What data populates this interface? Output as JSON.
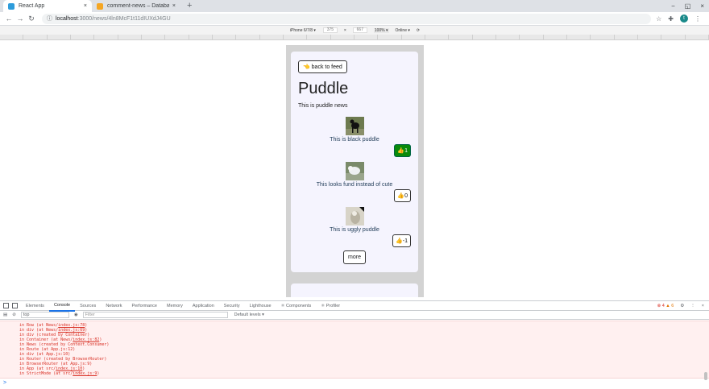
{
  "browser": {
    "tabs": [
      {
        "title": "React App",
        "close": "×",
        "color": "#2d9cdb",
        "active": true
      },
      {
        "title": "comment-news – Databa",
        "close": "×",
        "color": "#f5a623",
        "active": false
      }
    ],
    "new_tab": "+",
    "window_controls": [
      "−",
      "◱",
      "×"
    ],
    "url_host": "localhost",
    "url_path": ":3000/news/4ln8McF1t11dIUXdJ4GU",
    "profile_initial": "t"
  },
  "device_toolbar": {
    "device": "iPhone 6/7/8 ▾",
    "width": "375",
    "times": "×",
    "height": "667",
    "zoom": "100% ▾",
    "network": "Online ▾"
  },
  "page": {
    "back_label": "👈 back to feed",
    "title": "Puddle",
    "description": "This is puddle news",
    "comments": [
      {
        "text": "This is black puddle",
        "likes": "👍1",
        "liked": true
      },
      {
        "text": "This looks fund instead of cute",
        "likes": "👍0",
        "liked": false
      },
      {
        "text": "This is uggly puddle",
        "likes": "👍-1",
        "liked": false
      }
    ],
    "more_label": "more"
  },
  "devtools": {
    "tabs": [
      "Elements",
      "Console",
      "Sources",
      "Network",
      "Performance",
      "Memory",
      "Application",
      "Security",
      "Lighthouse",
      "⚛ Components",
      "⚛ Profiler"
    ],
    "active_tab": "Console",
    "errors": "4",
    "warnings": "6",
    "context": "top",
    "filter_placeholder": "Filter",
    "levels": "Default levels ▾",
    "lines": [
      {
        "pre": "in Row (at News/",
        "link": "index.js:78",
        "post": ")"
      },
      {
        "pre": "in div (at News/",
        "link": "index.js:69",
        "post": ")"
      },
      {
        "pre": "in div (created by Container)",
        "link": "",
        "post": ""
      },
      {
        "pre": "in Container (at News/",
        "link": "index.js:82",
        "post": ")"
      },
      {
        "pre": "in News (created by Context.Consumer)",
        "link": "",
        "post": ""
      },
      {
        "pre": "in Route (at App.js:12)",
        "link": "",
        "post": ""
      },
      {
        "pre": "in div (at App.js:10)",
        "link": "",
        "post": ""
      },
      {
        "pre": "in Router (created by BrowserRouter)",
        "link": "",
        "post": ""
      },
      {
        "pre": "in BrowserRouter (at App.js:9)",
        "link": "",
        "post": ""
      },
      {
        "pre": "in App (at src/",
        "link": "index.js:10",
        "post": ")"
      },
      {
        "pre": "in StrictMode (at src/",
        "link": "index.js:9",
        "post": ")"
      }
    ],
    "prompt": ">"
  }
}
